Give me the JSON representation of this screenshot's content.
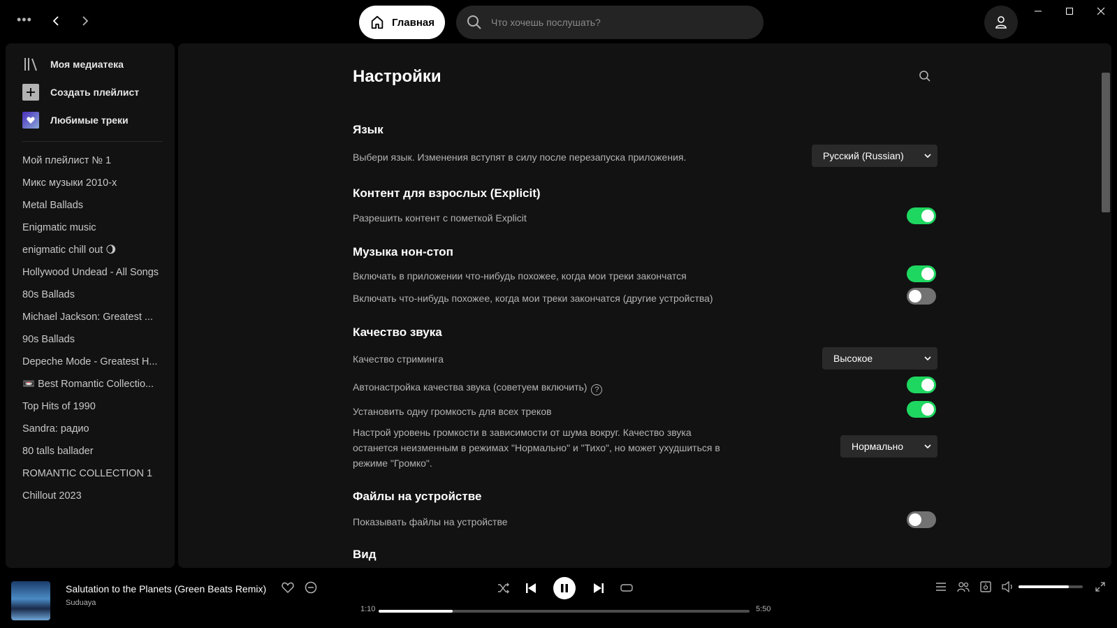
{
  "topbar": {
    "more_icon": "more-dots-icon",
    "home_label": "Главная",
    "search_placeholder": "Что хочешь послушать?"
  },
  "sidebar": {
    "library_label": "Моя медиатека",
    "create_playlist_label": "Создать плейлист",
    "liked_songs_label": "Любимые треки",
    "playlists": [
      "Мой плейлист № 1",
      "Микс музыки 2010-х",
      "Metal Ballads",
      "Enigmatic music",
      "enigmatic chill out 🌖",
      "Hollywood Undead - All Songs",
      "80s Ballads",
      "Michael Jackson: Greatest ...",
      "90s Ballads",
      "Depeche Mode - Greatest H...",
      "📼 Best Romantic Collectio...",
      "Top Hits of 1990",
      "Sandra: радио",
      "80 talls ballader",
      "ROMANTIC COLLECTION 1",
      "Chillout 2023"
    ]
  },
  "settings": {
    "title": "Настройки",
    "language": {
      "title": "Язык",
      "description": "Выбери язык. Изменения вступят в силу после перезапуска приложения.",
      "selected": "Русский (Russian)"
    },
    "explicit": {
      "title": "Контент для взрослых (Explicit)",
      "allow_label": "Разрешить контент с пометкой Explicit",
      "allow_on": true
    },
    "autoplay": {
      "title": "Музыка нон-стоп",
      "this_device_label": "Включать в приложении что-нибудь похожее, когда мои треки закончатся",
      "this_device_on": true,
      "other_devices_label": "Включать что-нибудь похожее, когда мои треки закончатся (другие устройства)",
      "other_devices_on": false
    },
    "audio_quality": {
      "title": "Качество звука",
      "streaming_label": "Качество стриминга",
      "streaming_value": "Высокое",
      "auto_adjust_label": "Автонастройка качества звука (советуем включить)",
      "auto_adjust_on": true,
      "normalize_label": "Установить одну громкость для всех треков",
      "normalize_on": true,
      "volume_level_line1": "Настрой уровень громкости в зависимости от шума вокруг. Качество звука",
      "volume_level_line2": "останется неизменным в режимах \"Нормально\" и \"Тихо\", но может ухудшиться в",
      "volume_level_line3": "режиме \"Громко\".",
      "volume_level_value": "Нормально"
    },
    "local_files": {
      "title": "Файлы на устройстве",
      "show_label": "Показывать файлы на устройстве",
      "show_on": false
    },
    "display": {
      "title": "Вид"
    }
  },
  "player": {
    "track_title": "Salutation to the Planets (Green Beats Remix)",
    "artist": "Suduaya",
    "elapsed": "1:10",
    "duration": "5:50",
    "progress_fraction": 0.2,
    "volume_fraction": 0.78,
    "accent_color": "#1ed760"
  }
}
